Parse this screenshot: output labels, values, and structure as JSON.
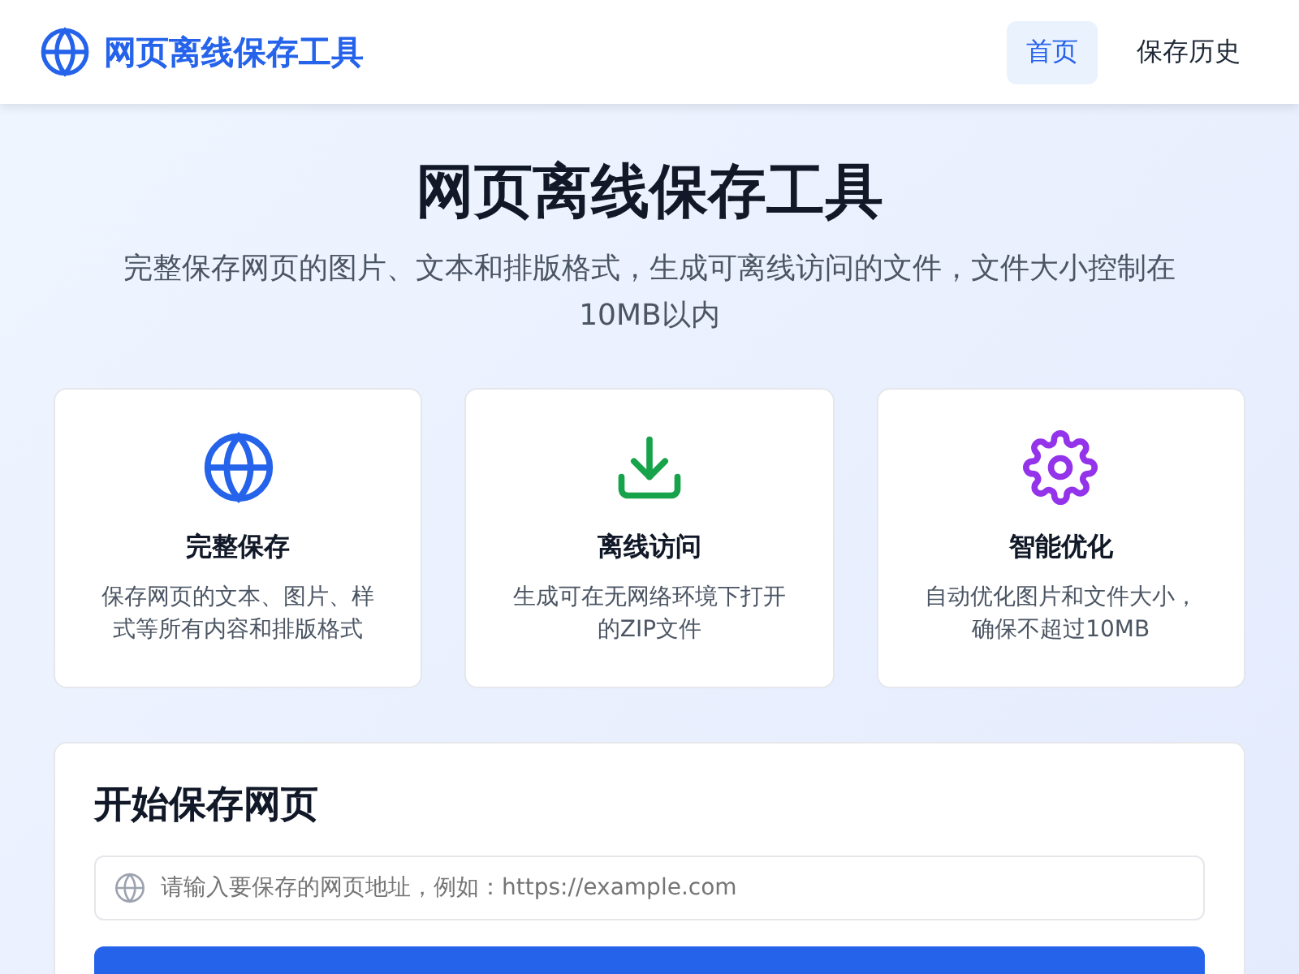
{
  "header": {
    "title": "网页离线保存工具",
    "nav": [
      {
        "label": "首页",
        "selected": true
      },
      {
        "label": "保存历史",
        "selected": false
      }
    ]
  },
  "hero": {
    "title": "网页离线保存工具",
    "subtitle": "完整保存网页的图片、文本和排版格式，生成可离线访问的文件，文件大小控制在10MB以内"
  },
  "features": [
    {
      "kind": "globe",
      "color": "#2563eb",
      "title": "完整保存",
      "description": "保存网页的文本、图片、样式等所有内容和排版格式"
    },
    {
      "kind": "download",
      "color": "#16a34a",
      "title": "离线访问",
      "description": "生成可在无网络环境下打开的ZIP文件"
    },
    {
      "kind": "gear",
      "color": "#9333ea",
      "title": "智能优化",
      "description": "自动优化图片和文件大小，确保不超过10MB"
    }
  ],
  "form": {
    "title": "开始保存网页",
    "url_field": {
      "placeholder": "请输入要保存的网页地址，例如：https://example.com"
    }
  }
}
